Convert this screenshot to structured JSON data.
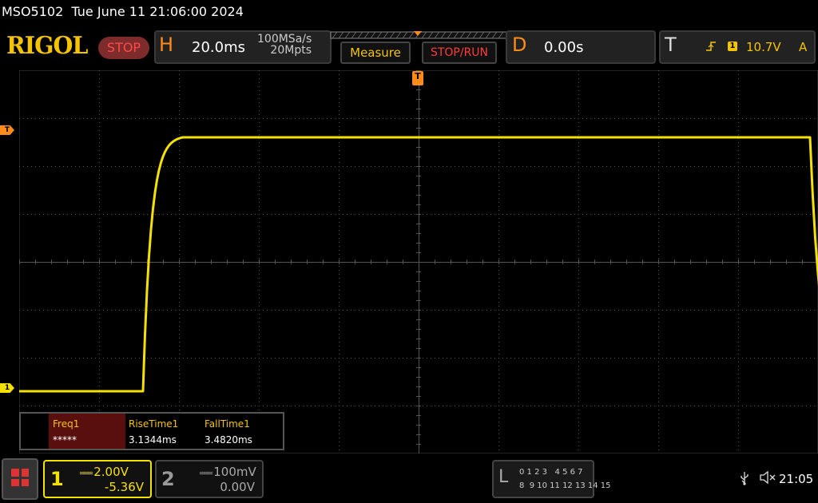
{
  "header": {
    "title": "MSO5102  Tue June 11 21:06:00 2024"
  },
  "toolbar": {
    "logo": "RIGOL",
    "run_state": "STOP",
    "horizontal": {
      "letter": "H",
      "timebase": "20.0ms",
      "sample_rate": "100MSa/s",
      "memory_depth": "20Mpts"
    },
    "measure_label": "Measure",
    "stop_run_label": "STOP/RUN",
    "delay": {
      "letter": "D",
      "value": "0.00s"
    },
    "trigger": {
      "letter": "T",
      "edge_icon": "rising-edge-icon",
      "channel": "1",
      "level": "10.7V",
      "mode": "A"
    }
  },
  "markers": {
    "trigger_position": "T",
    "trigger_level": "T",
    "channel1": "1"
  },
  "waveform": {
    "color": "#f5e100",
    "volts_per_div": 2.0,
    "time_per_div_ms": 20.0,
    "low_level_div_from_bottom": 1.3,
    "high_level_div_from_bottom": 6.6,
    "rise_start_div": 1.55,
    "rise_end_div": 2.05,
    "fall_start_div": 9.9,
    "fall_end_div": 10.55
  },
  "measurements": {
    "items": [
      {
        "label": "Freq1",
        "value": "*****"
      },
      {
        "label": "RiseTime1",
        "value": "3.1344ms"
      },
      {
        "label": "FallTime1",
        "value": "3.4820ms"
      }
    ]
  },
  "channels": {
    "ch1": {
      "number": "1",
      "scale": "2.00V",
      "offset": "-5.36V",
      "coupling_icon": "dc-coupling-icon"
    },
    "ch2": {
      "number": "2",
      "scale": "100mV",
      "offset": "0.00V",
      "coupling_icon": "dc-coupling-icon"
    }
  },
  "logic": {
    "letter": "L",
    "row1": "0 1 2 3   4 5 6 7",
    "row2": "8  9 10 11 12 13 14 15"
  },
  "status": {
    "time": "21:05"
  }
}
